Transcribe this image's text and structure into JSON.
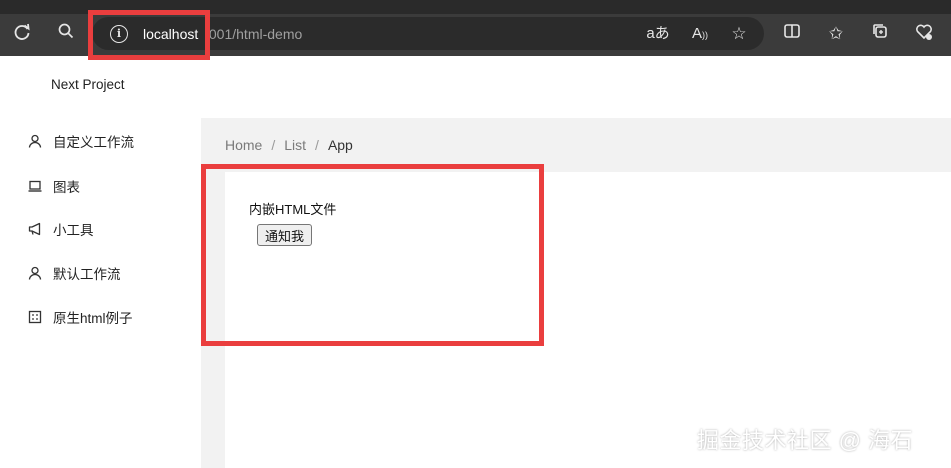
{
  "browser": {
    "host": "localhost",
    "path": ":001/html-demo"
  },
  "sidebar": {
    "project_title": "Next Project",
    "items": [
      {
        "label": "自定义工作流",
        "icon": "user-icon"
      },
      {
        "label": "图表",
        "icon": "laptop-icon"
      },
      {
        "label": "小工具",
        "icon": "megaphone-icon"
      },
      {
        "label": "默认工作流",
        "icon": "user-icon"
      },
      {
        "label": "原生html例子",
        "icon": "calculator-icon"
      }
    ]
  },
  "breadcrumb": {
    "items": [
      "Home",
      "List",
      "App"
    ],
    "separator": "/"
  },
  "content": {
    "embed_title": "内嵌HTML文件",
    "button_label": "通知我"
  },
  "watermark": "掘金技术社区 @ 海石",
  "colors": {
    "highlight": "#ea3e3e",
    "browser_chrome": "#3b3b3b",
    "content_bg": "#f2f2f2"
  }
}
